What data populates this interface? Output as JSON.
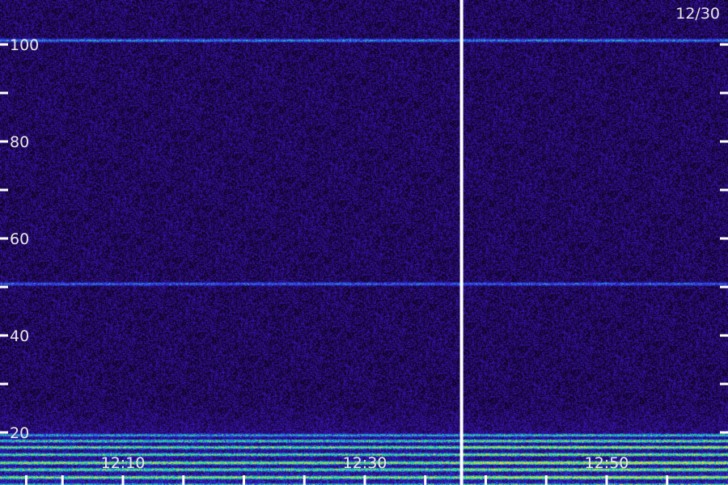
{
  "chart_data": {
    "type": "heatmap",
    "title": "",
    "xlabel": "",
    "ylabel": "",
    "date_label": "12/30",
    "x_time_range": [
      "12:00",
      "13:00"
    ],
    "y_range": [
      8,
      110
    ],
    "y_ticks_labeled": [
      20,
      40,
      60,
      80,
      100
    ],
    "y_ticks_minor": [
      30,
      50,
      70,
      90
    ],
    "x_tick_labels": [
      "12:10",
      "12:30",
      "12:50"
    ],
    "x_tick_minutes": [
      2,
      5,
      10,
      15,
      20,
      25,
      30,
      35,
      40,
      45,
      50,
      55
    ],
    "x_tick_labeled_minutes": [
      10,
      30,
      50
    ],
    "marker_line_time": "12:38",
    "marker_line_minutes": 38,
    "colormap": [
      "#000000",
      "#2a0a6e",
      "#3a18c8",
      "#1f5fe0",
      "#19c8c0",
      "#2ee86a",
      "#d8e040"
    ],
    "background_level": 0.22,
    "bright_bands": [
      {
        "y": 100.9,
        "intensity": 0.55
      },
      {
        "y": 50.7,
        "intensity": 0.45
      },
      {
        "y": 19.5,
        "intensity": 0.55
      },
      {
        "y": 18.3,
        "intensity": 0.7
      },
      {
        "y": 17.0,
        "intensity": 0.85
      },
      {
        "y": 15.5,
        "intensity": 0.75
      },
      {
        "y": 13.8,
        "intensity": 0.95
      },
      {
        "y": 12.4,
        "intensity": 0.8
      },
      {
        "y": 10.8,
        "intensity": 0.9
      },
      {
        "y": 9.2,
        "intensity": 0.7
      }
    ]
  }
}
